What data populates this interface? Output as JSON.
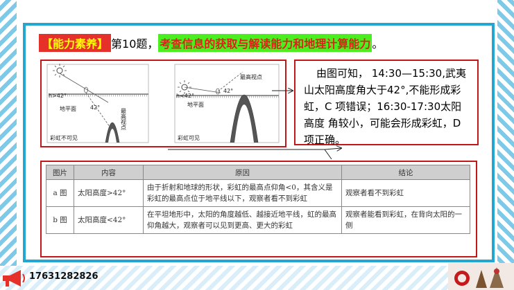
{
  "heading": {
    "tag": "【能力素养】",
    "prefix": "第10题，",
    "highlight": "考查信息的获取与解读能力和地理计算能力",
    "suffix": "。"
  },
  "diagram_left": {
    "h_label": "h>42°",
    "angle_label": "42°",
    "ground_label": "地平面",
    "top_label": "最高视点",
    "caption": "彩虹不可见"
  },
  "diagram_right": {
    "h_label": "h<42°",
    "angle_label": "42°",
    "ground_label": "地平面",
    "top_label": "最高视点",
    "caption": "彩虹可见"
  },
  "callout": {
    "text": "由图可知， 14:30—15:30,武夷山太阳高度角大于42°,不能形成彩虹，C 项错误；16:30-17:30太阳高度 角较小，可能会形成彩虹，D 项正确。"
  },
  "table": {
    "headers": [
      "图片",
      "内容",
      "原因",
      "结论"
    ],
    "rows": [
      {
        "pic": "a 图",
        "content": "太阳高度>42°",
        "reason": "由于折射和地球的形状，彩虹的最高点仰角<0，其含义是彩虹的最高点位于地平线以下，观察者看不到彩虹",
        "conclusion": "观察者看不到彩虹"
      },
      {
        "pic": "b 图",
        "content": "太阳高度<42°",
        "reason": "在平坦地形中，太阳的角度越低、越接近地平线，虹的最高仰角越大，观察者可以见到更高、更大的彩虹",
        "conclusion": "观察者能看到彩虹，在背向太阳的一侧"
      }
    ]
  },
  "footer": {
    "phone": "17631282826"
  }
}
